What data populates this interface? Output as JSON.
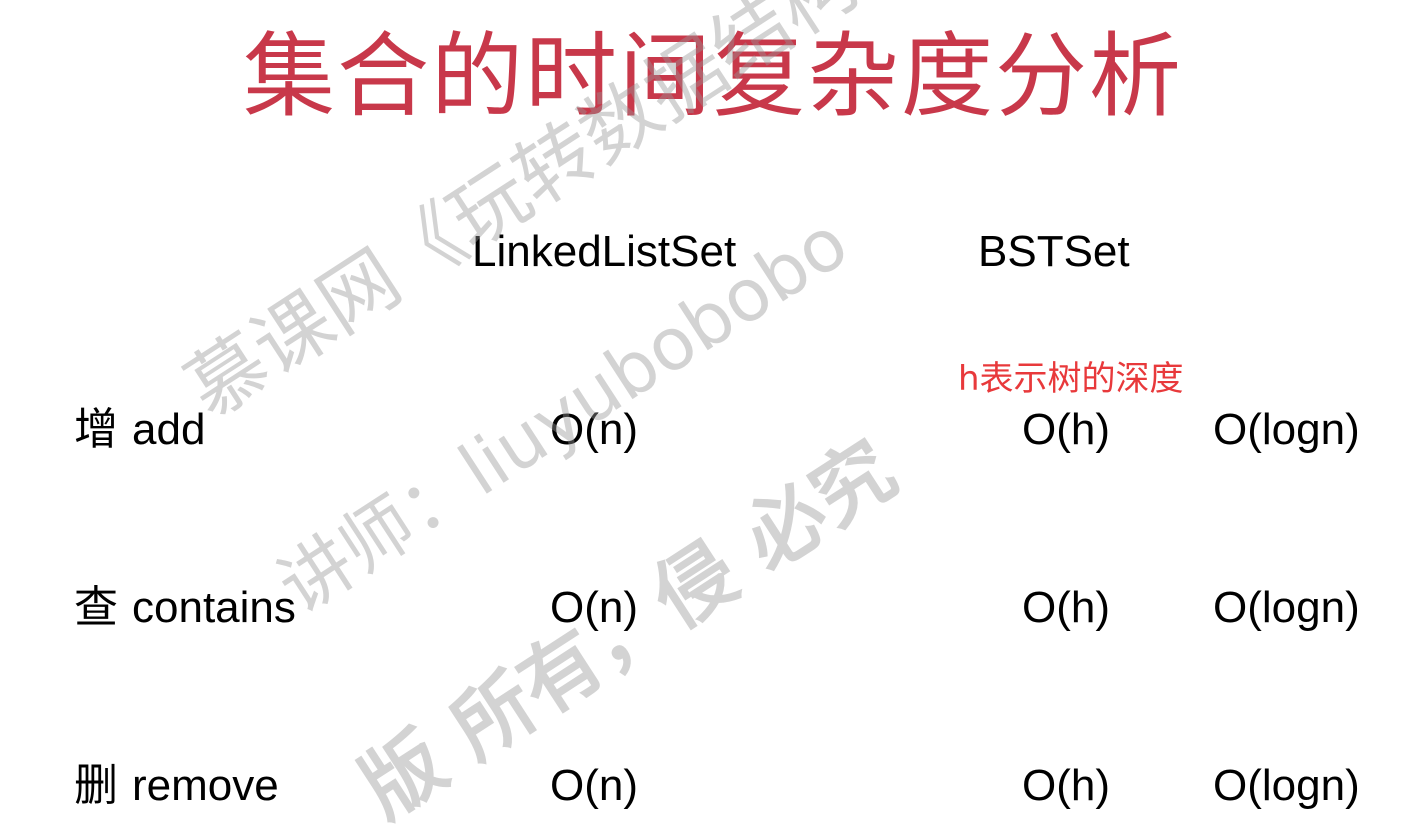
{
  "title": "集合的时间复杂度分析",
  "columns": {
    "linked": "LinkedListSet",
    "bst": "BSTSet"
  },
  "annotation": "h表示树的深度",
  "rows": [
    {
      "op_cn": "增",
      "op_en": "add",
      "linked": "O(n)",
      "bst_h": "O(h)",
      "bst_logn": "O(logn)"
    },
    {
      "op_cn": "查",
      "op_en": "contains",
      "linked": "O(n)",
      "bst_h": "O(h)",
      "bst_logn": "O(logn)"
    },
    {
      "op_cn": "删",
      "op_en": "remove",
      "linked": "O(n)",
      "bst_h": "O(h)",
      "bst_logn": "O(logn)"
    }
  ],
  "watermark": {
    "line1": "慕课网《玩转数据结构》",
    "line2": "讲师：liuyubobobo",
    "line3": "版 所有，侵 必究"
  },
  "colors": {
    "title": "#c8384a",
    "annotation": "#e8393b",
    "text": "#000000"
  }
}
